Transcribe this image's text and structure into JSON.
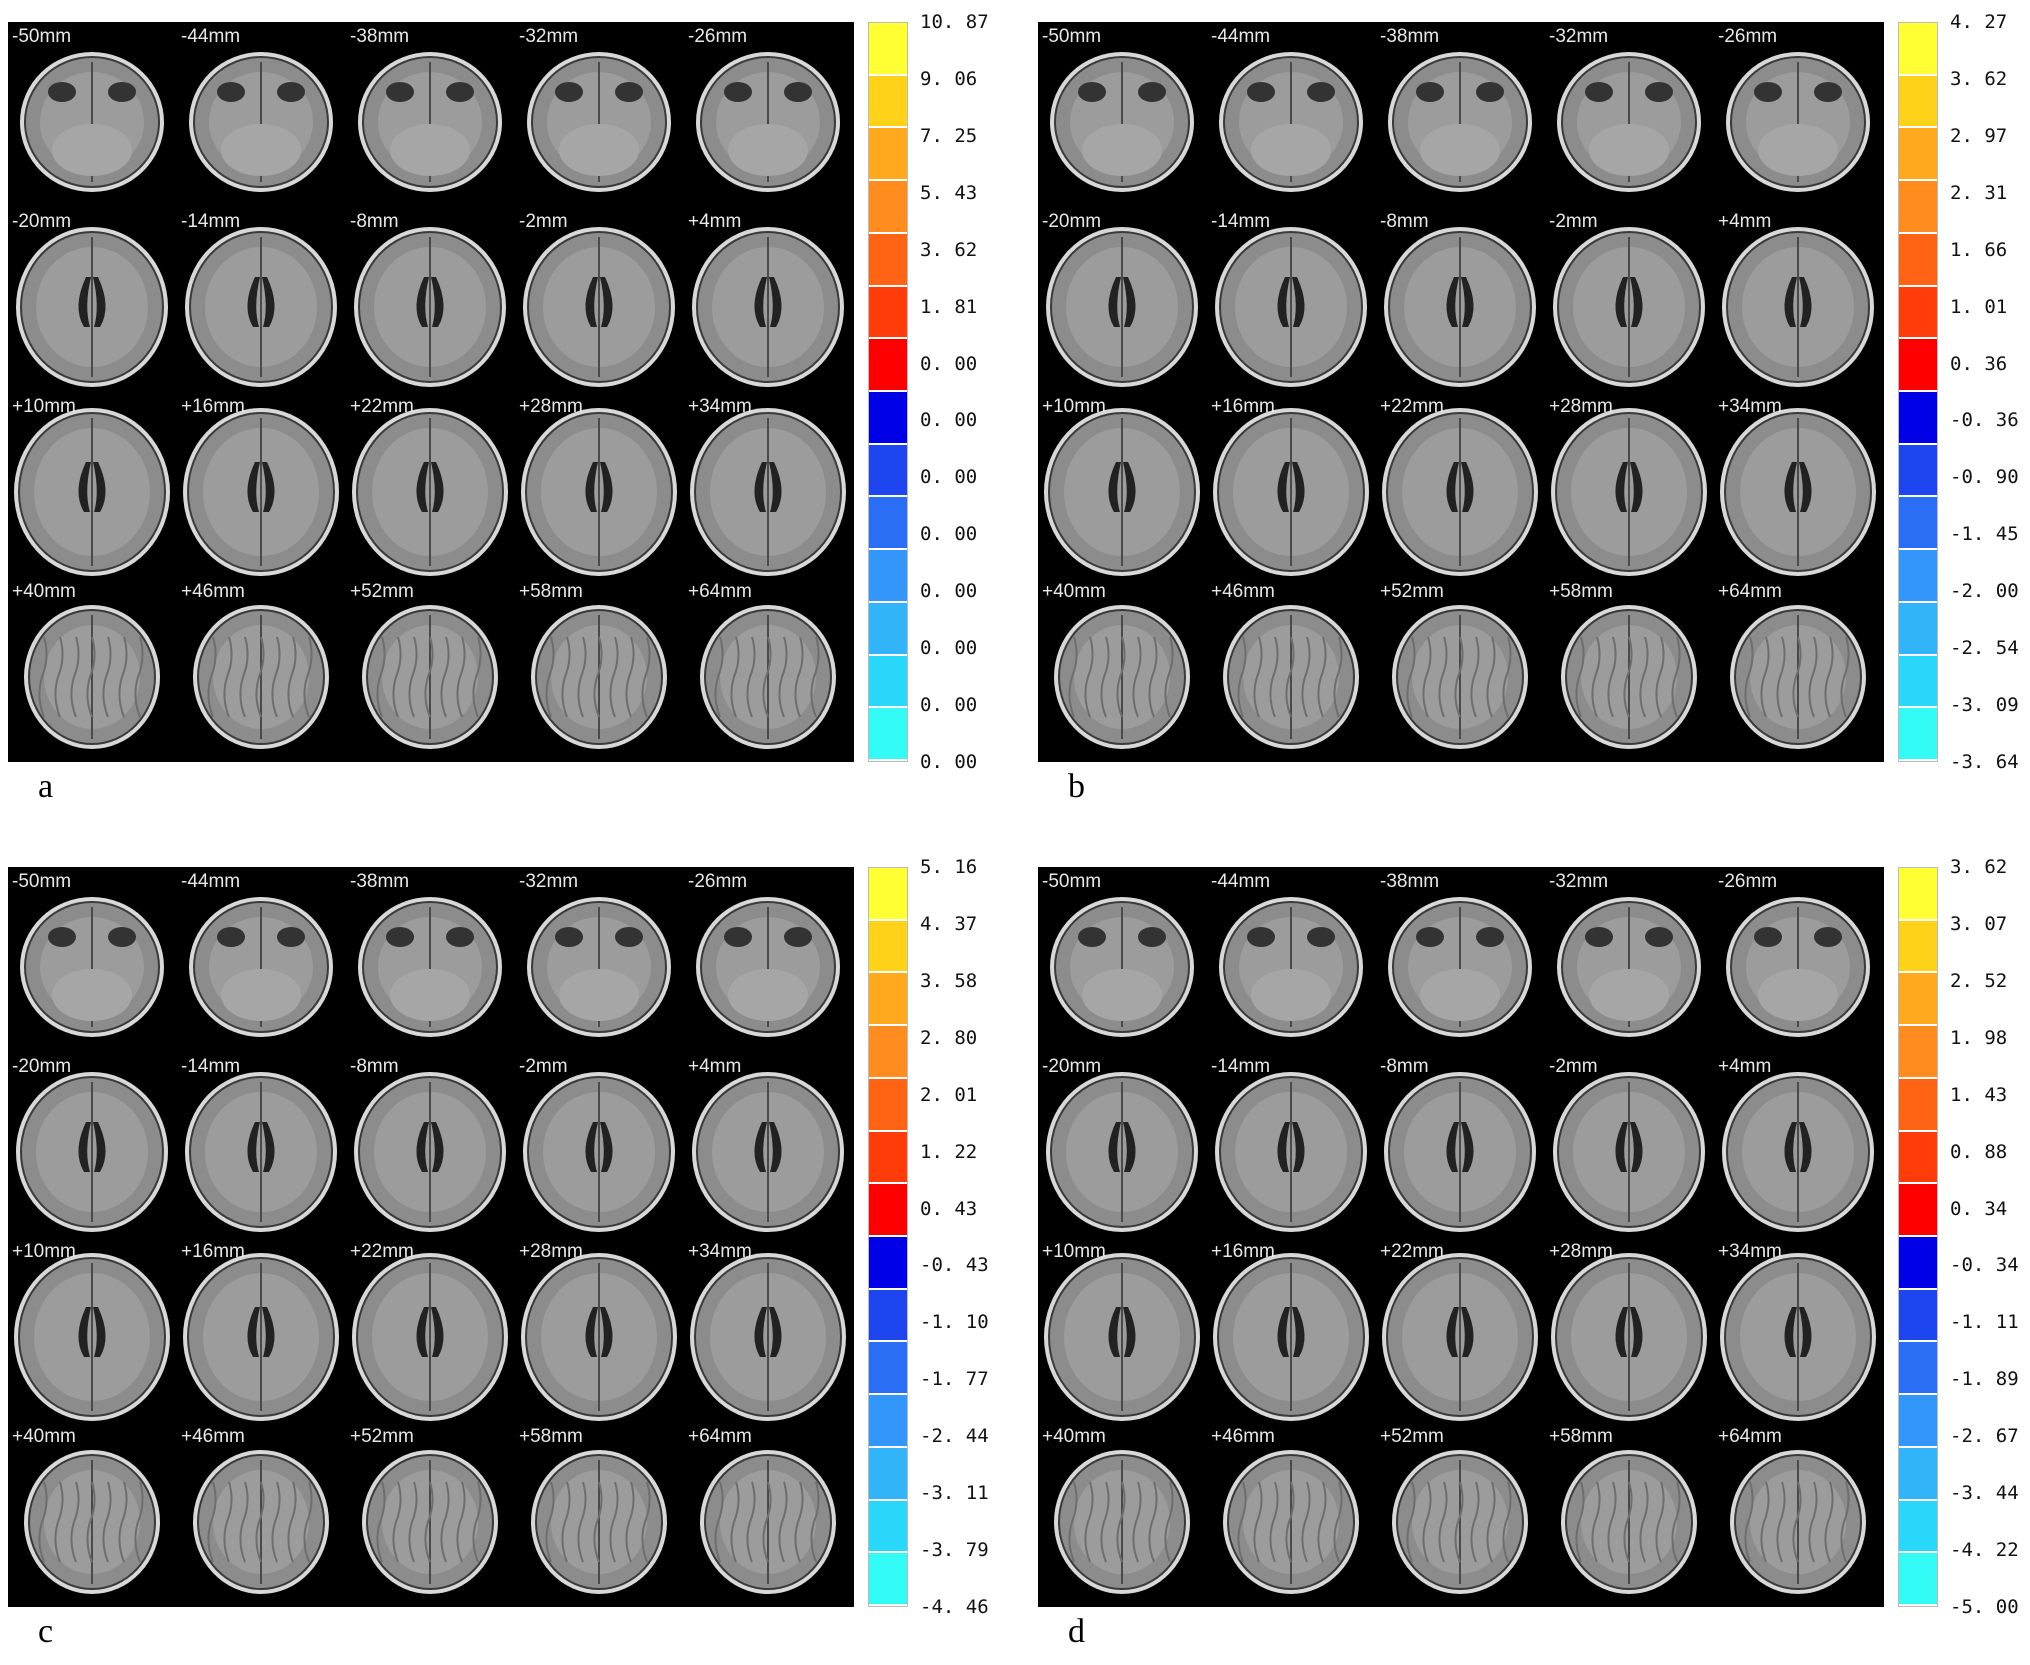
{
  "panels": [
    {
      "letter": "a",
      "colorbar_ticks": [
        "10. 87",
        "9. 06",
        "7. 25",
        "5. 43",
        "3. 62",
        "1. 81",
        "0. 00",
        "0. 00",
        "0. 00",
        "0. 00",
        "0. 00",
        "0. 00",
        "0. 00",
        "0. 00"
      ],
      "slices": [
        "-50mm",
        "-44mm",
        "-38mm",
        "-32mm",
        "-26mm",
        "-20mm",
        "-14mm",
        "-8mm",
        "-2mm",
        "+4mm",
        "+10mm",
        "+16mm",
        "+22mm",
        "+28mm",
        "+34mm",
        "+40mm",
        "+46mm",
        "+52mm",
        "+58mm",
        "+64mm"
      ]
    },
    {
      "letter": "b",
      "colorbar_ticks": [
        "4. 27",
        "3. 62",
        "2. 97",
        "2. 31",
        "1. 66",
        "1. 01",
        "0. 36",
        "-0. 36",
        "-0. 90",
        "-1. 45",
        "-2. 00",
        "-2. 54",
        "-3. 09",
        "-3. 64"
      ],
      "slices": [
        "-50mm",
        "-44mm",
        "-38mm",
        "-32mm",
        "-26mm",
        "-20mm",
        "-14mm",
        "-8mm",
        "-2mm",
        "+4mm",
        "+10mm",
        "+16mm",
        "+22mm",
        "+28mm",
        "+34mm",
        "+40mm",
        "+46mm",
        "+52mm",
        "+58mm",
        "+64mm"
      ]
    },
    {
      "letter": "c",
      "colorbar_ticks": [
        "5. 16",
        "4. 37",
        "3. 58",
        "2. 80",
        "2. 01",
        "1. 22",
        "0. 43",
        "-0. 43",
        "-1. 10",
        "-1. 77",
        "-2. 44",
        "-3. 11",
        "-3. 79",
        "-4. 46"
      ],
      "slices": [
        "-50mm",
        "-44mm",
        "-38mm",
        "-32mm",
        "-26mm",
        "-20mm",
        "-14mm",
        "-8mm",
        "-2mm",
        "+4mm",
        "+10mm",
        "+16mm",
        "+22mm",
        "+28mm",
        "+34mm",
        "+40mm",
        "+46mm",
        "+52mm",
        "+58mm",
        "+64mm"
      ]
    },
    {
      "letter": "d",
      "colorbar_ticks": [
        "3. 62",
        "3. 07",
        "2. 52",
        "1. 98",
        "1. 43",
        "0. 88",
        "0. 34",
        "-0. 34",
        "-1. 11",
        "-1. 89",
        "-2. 67",
        "-3. 44",
        "-4. 22",
        "-5. 00"
      ],
      "slices": [
        "-50mm",
        "-44mm",
        "-38mm",
        "-32mm",
        "-26mm",
        "-20mm",
        "-14mm",
        "-8mm",
        "-2mm",
        "+4mm",
        "+10mm",
        "+16mm",
        "+22mm",
        "+28mm",
        "+34mm",
        "+40mm",
        "+46mm",
        "+52mm",
        "+58mm",
        "+64mm"
      ]
    }
  ],
  "colorbar_colors": [
    "#ffff33",
    "#ffd21a",
    "#ffaa1e",
    "#ff8c1e",
    "#ff6414",
    "#ff3c0a",
    "#ff0000",
    "#0000e6",
    "#1e46f0",
    "#2a6ef5",
    "#3296fa",
    "#32b4fa",
    "#28d7fa",
    "#32faf5"
  ]
}
